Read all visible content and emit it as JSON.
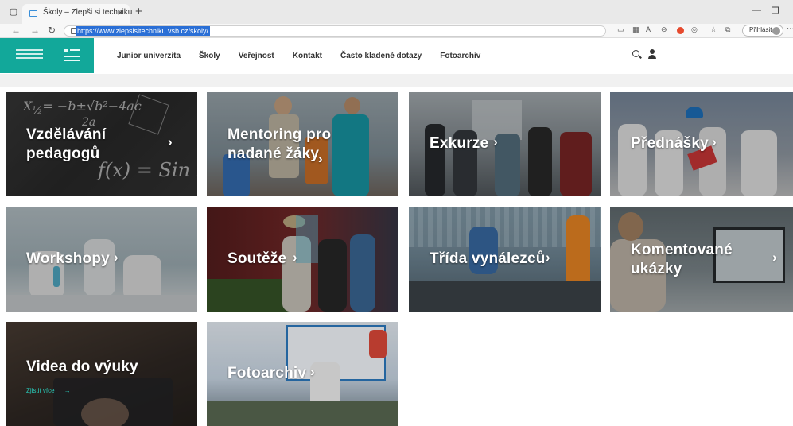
{
  "browser": {
    "tab_title": "Školy – Zlepši si techniku",
    "tab_close": "×",
    "new_tab": "+",
    "url": "https://www.zlepsisitechniku.vsb.cz/skoly/",
    "signin_label": "Přihlásit"
  },
  "colors": {
    "accent": "#12a89a",
    "cta": "#29c9b8",
    "url_highlight": "#2a6fd6"
  },
  "site": {
    "nav": [
      {
        "label": "Junior univerzita"
      },
      {
        "label": "Školy"
      },
      {
        "label": "Veřejnost"
      },
      {
        "label": "Kontakt"
      },
      {
        "label": "Často kladené dotazy"
      },
      {
        "label": "Fotoarchiv"
      }
    ],
    "icons": [
      "search-icon",
      "user-icon"
    ]
  },
  "tiles": [
    {
      "line1": "Vzdělávání",
      "line2": "pedagogů"
    },
    {
      "line1": "Mentoring pro",
      "line2": "nadané žáky"
    },
    {
      "line1": "Exkurze"
    },
    {
      "line1": "Přednášky"
    },
    {
      "line1": "Workshopy"
    },
    {
      "line1": "Soutěže"
    },
    {
      "line1": "Třída vynálezců"
    },
    {
      "line1": "Komentované",
      "line2": "ukázky"
    },
    {
      "line1": "Videa do výuky",
      "cta": "Zjistit více"
    },
    {
      "line1": "Fotoarchiv"
    }
  ],
  "arrow_glyph": "›",
  "cta_arrow_glyph": "→"
}
